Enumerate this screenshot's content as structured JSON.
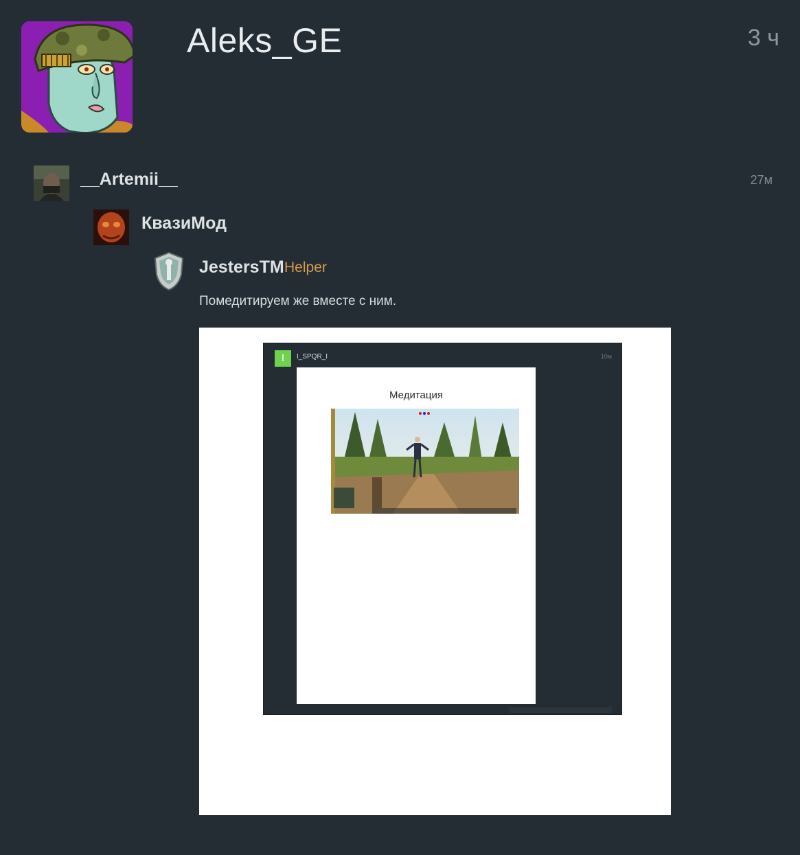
{
  "post": {
    "author": "Aleks_GE",
    "time": "3 ч"
  },
  "comments": [
    {
      "name": "__Artemii__",
      "time": "27м"
    },
    {
      "name": "КвазиМод"
    },
    {
      "name": "JestersTM",
      "badge": "Helper",
      "text": "Помедитируем же вместе с ним."
    }
  ],
  "attachment": {
    "user": "I_SPQR_I",
    "avatar_letter": "I",
    "time": "10м",
    "title": "Медитация"
  }
}
